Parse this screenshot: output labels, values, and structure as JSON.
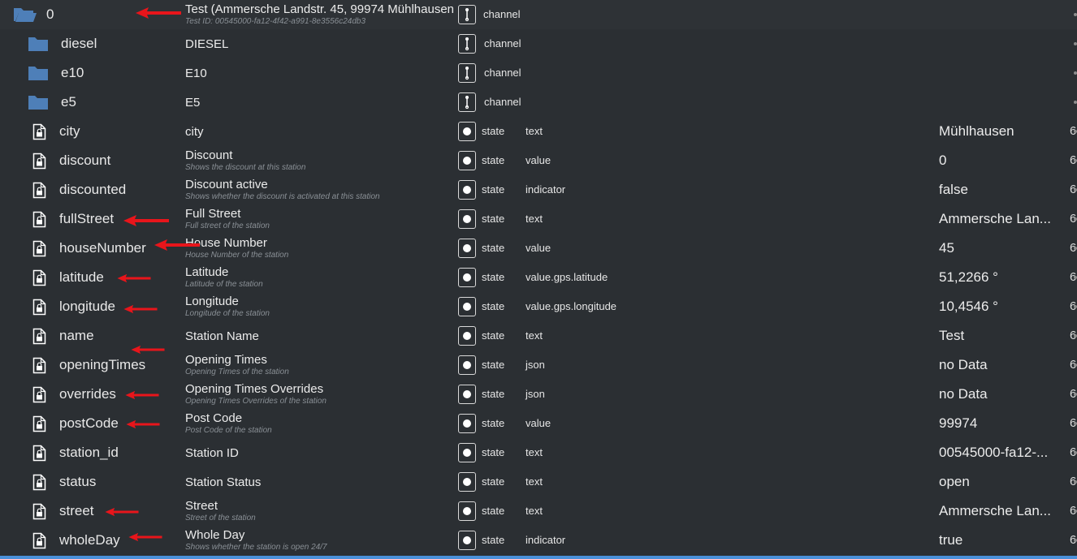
{
  "rows": [
    {
      "name": "0",
      "title": "Test (Ammersche Landstr. 45, 99974 Mühlhausen)",
      "desc": "Test ID: 00545000-fa12-4f42-a991-8e3556c24db3",
      "type": "channel",
      "role": "",
      "value": "",
      "extra": ""
    },
    {
      "name": "diesel",
      "title": "DIESEL",
      "desc": "",
      "type": "channel",
      "role": "",
      "value": "",
      "extra": ""
    },
    {
      "name": "e10",
      "title": "E10",
      "desc": "",
      "type": "channel",
      "role": "",
      "value": "",
      "extra": ""
    },
    {
      "name": "e5",
      "title": "E5",
      "desc": "",
      "type": "channel",
      "role": "",
      "value": "",
      "extra": ""
    },
    {
      "name": "city",
      "title": "city",
      "desc": "",
      "type": "state",
      "role": "text",
      "value": "Mühlhausen",
      "extra": "6"
    },
    {
      "name": "discount",
      "title": "Discount",
      "desc": "Shows the discount at this station",
      "type": "state",
      "role": "value",
      "value": "0",
      "extra": "6"
    },
    {
      "name": "discounted",
      "title": "Discount active",
      "desc": "Shows whether the discount is activated at this station",
      "type": "state",
      "role": "indicator",
      "value": "false",
      "extra": "6"
    },
    {
      "name": "fullStreet",
      "title": "Full Street",
      "desc": "Full street of the station",
      "type": "state",
      "role": "text",
      "value": "Ammersche Lan...",
      "extra": "6"
    },
    {
      "name": "houseNumber",
      "title": "House Number",
      "desc": "House Number of the station",
      "type": "state",
      "role": "value",
      "value": "45",
      "extra": "6"
    },
    {
      "name": "latitude",
      "title": "Latitude",
      "desc": "Latitude of the station",
      "type": "state",
      "role": "value.gps.latitude",
      "value": "51,2266 °",
      "extra": "6"
    },
    {
      "name": "longitude",
      "title": "Longitude",
      "desc": "Longitude of the station",
      "type": "state",
      "role": "value.gps.longitude",
      "value": "10,4546 °",
      "extra": "6"
    },
    {
      "name": "name",
      "title": "Station Name",
      "desc": "",
      "type": "state",
      "role": "text",
      "value": "Test",
      "extra": "6"
    },
    {
      "name": "openingTimes",
      "title": "Opening Times",
      "desc": "Opening Times of the station",
      "type": "state",
      "role": "json",
      "value": "no Data",
      "extra": "6"
    },
    {
      "name": "overrides",
      "title": "Opening Times Overrides",
      "desc": "Opening Times Overrides of the station",
      "type": "state",
      "role": "json",
      "value": "no Data",
      "extra": "6"
    },
    {
      "name": "postCode",
      "title": "Post Code",
      "desc": "Post Code of the station",
      "type": "state",
      "role": "value",
      "value": "99974",
      "extra": "6"
    },
    {
      "name": "station_id",
      "title": "Station ID",
      "desc": "",
      "type": "state",
      "role": "text",
      "value": "00545000-fa12-...",
      "extra": "6"
    },
    {
      "name": "status",
      "title": "Station Status",
      "desc": "",
      "type": "state",
      "role": "text",
      "value": "open",
      "extra": "6"
    },
    {
      "name": "street",
      "title": "Street",
      "desc": "Street of the station",
      "type": "state",
      "role": "text",
      "value": "Ammersche Lan...",
      "extra": "6"
    },
    {
      "name": "wholeDay",
      "title": "Whole Day",
      "desc": "Shows whether the station is open 24/7",
      "type": "state",
      "role": "indicator",
      "value": "true",
      "extra": "6"
    }
  ],
  "colors": {
    "background": "#2b2f33",
    "folder": "#4e7fb8",
    "arrow": "#e8151b",
    "accent_bar": "#4a90d9"
  },
  "icons": {
    "folder_open": "folder-open-icon",
    "folder": "folder-icon",
    "state_file": "file-lock-icon",
    "channel": "channel-icon",
    "state": "state-icon",
    "annotation": "red-arrow-icon"
  }
}
